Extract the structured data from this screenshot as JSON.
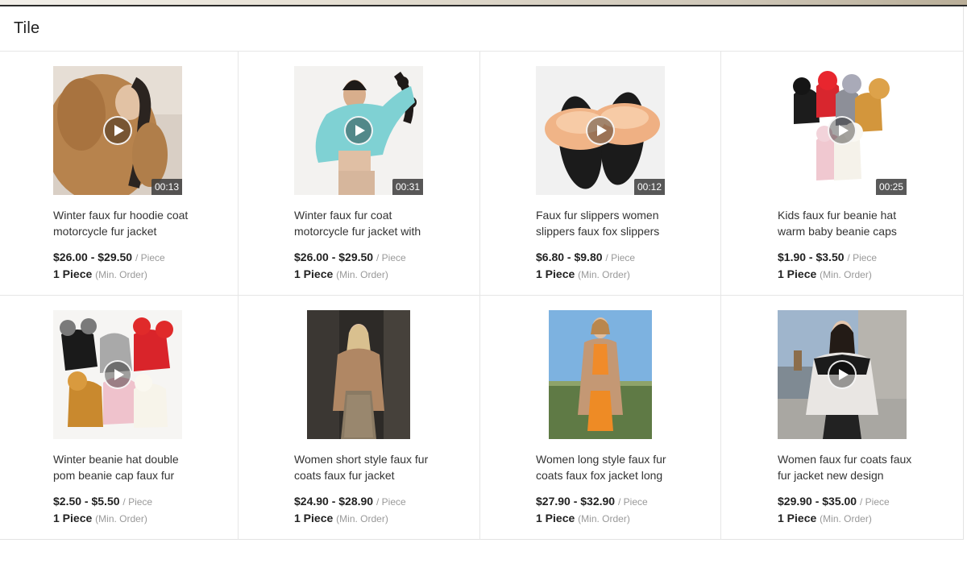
{
  "panel": {
    "title": "Tile"
  },
  "products": [
    {
      "title": "Winter faux fur hoodie coat motorcycle fur jacket",
      "price": "$26.00 - $29.50",
      "unit": "/ Piece",
      "moq": "1 Piece",
      "moq_note": "(Min. Order)",
      "has_video": true,
      "duration": "00:13"
    },
    {
      "title": "Winter faux fur coat motorcycle fur jacket with",
      "price": "$26.00 - $29.50",
      "unit": "/ Piece",
      "moq": "1 Piece",
      "moq_note": "(Min. Order)",
      "has_video": true,
      "duration": "00:31"
    },
    {
      "title": "Faux fur slippers women slippers faux fox slippers",
      "price": "$6.80 - $9.80",
      "unit": "/ Piece",
      "moq": "1 Piece",
      "moq_note": "(Min. Order)",
      "has_video": true,
      "duration": "00:12"
    },
    {
      "title": "Kids faux fur beanie hat warm baby beanie caps",
      "price": "$1.90 - $3.50",
      "unit": "/ Piece",
      "moq": "1 Piece",
      "moq_note": "(Min. Order)",
      "has_video": true,
      "duration": "00:25"
    },
    {
      "title": "Winter beanie hat double pom beanie cap faux fur",
      "price": "$2.50 - $5.50",
      "unit": "/ Piece",
      "moq": "1 Piece",
      "moq_note": "(Min. Order)",
      "has_video": true,
      "duration": ""
    },
    {
      "title": "Women short style faux fur coats faux fur jacket",
      "price": "$24.90 - $28.90",
      "unit": "/ Piece",
      "moq": "1 Piece",
      "moq_note": "(Min. Order)",
      "has_video": false,
      "duration": ""
    },
    {
      "title": "Women long style faux fur coats faux fox jacket long",
      "price": "$27.90 - $32.90",
      "unit": "/ Piece",
      "moq": "1 Piece",
      "moq_note": "(Min. Order)",
      "has_video": false,
      "duration": ""
    },
    {
      "title": "Women faux fur coats faux fur jacket new design",
      "price": "$29.90 - $35.00",
      "unit": "/ Piece",
      "moq": "1 Piece",
      "moq_note": "(Min. Order)",
      "has_video": true,
      "duration": ""
    }
  ],
  "icons": {
    "play": "play-icon"
  },
  "colors": {
    "price": "#222222",
    "muted": "#999999",
    "duration_bg": "#3c3c3c"
  }
}
